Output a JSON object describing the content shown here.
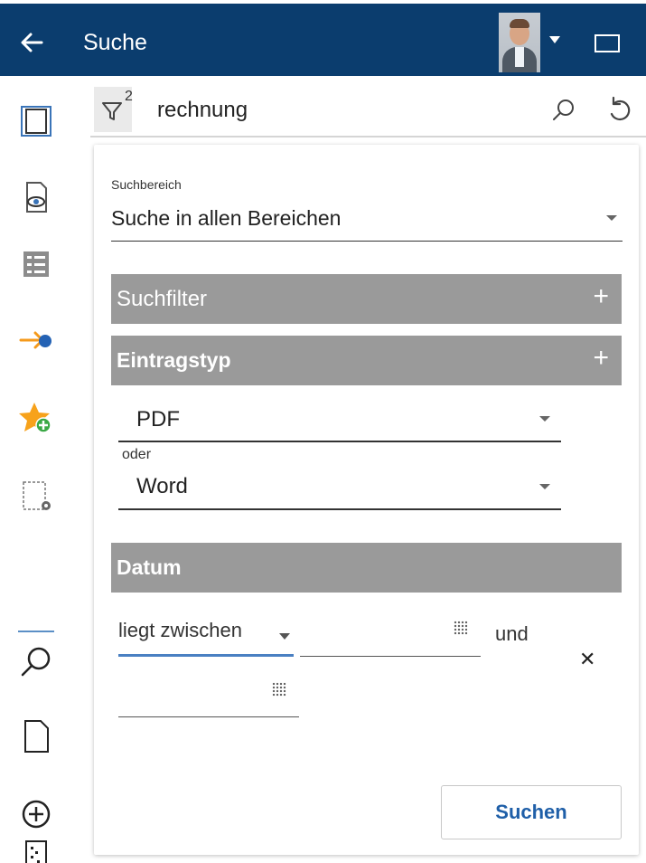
{
  "header": {
    "back_icon": "arrow-left-icon",
    "title": "Suche",
    "avatar_icon": "user-avatar",
    "panel_icon": "panel-toggle-icon",
    "bar_color": "#0b3d6e"
  },
  "rail": {
    "items": [
      {
        "icon": "document-icon",
        "active": true
      },
      {
        "icon": "document-preview-icon"
      },
      {
        "icon": "list-view-icon"
      },
      {
        "icon": "workflow-forward-icon"
      },
      {
        "icon": "add-favorite-icon"
      },
      {
        "icon": "selection-settings-icon"
      },
      {
        "icon": "search-icon"
      },
      {
        "icon": "new-document-icon"
      },
      {
        "icon": "add-circle-icon"
      },
      {
        "icon": "document-scan-icon"
      }
    ]
  },
  "searchbar": {
    "filter_icon": "filter-icon",
    "filter_count": "2",
    "query": "rechnung",
    "search_icon": "search-icon",
    "reset_icon": "reset-icon"
  },
  "form": {
    "scope": {
      "label": "Suchbereich",
      "value": "Suche in allen Bereichen"
    },
    "sections": {
      "filter": "Suchfilter",
      "type": "Eintragstyp",
      "date": "Datum"
    },
    "entry_type": {
      "first": "PDF",
      "connector": "oder",
      "second": "Word"
    },
    "date": {
      "operator": "liegt zwischen",
      "and_label": "und",
      "from_value": "",
      "to_value": ""
    },
    "submit": "Suchen"
  },
  "colors": {
    "accent": "#1f5fa8",
    "section_header": "#9a9a9a",
    "active_underline": "#4a80c2"
  }
}
